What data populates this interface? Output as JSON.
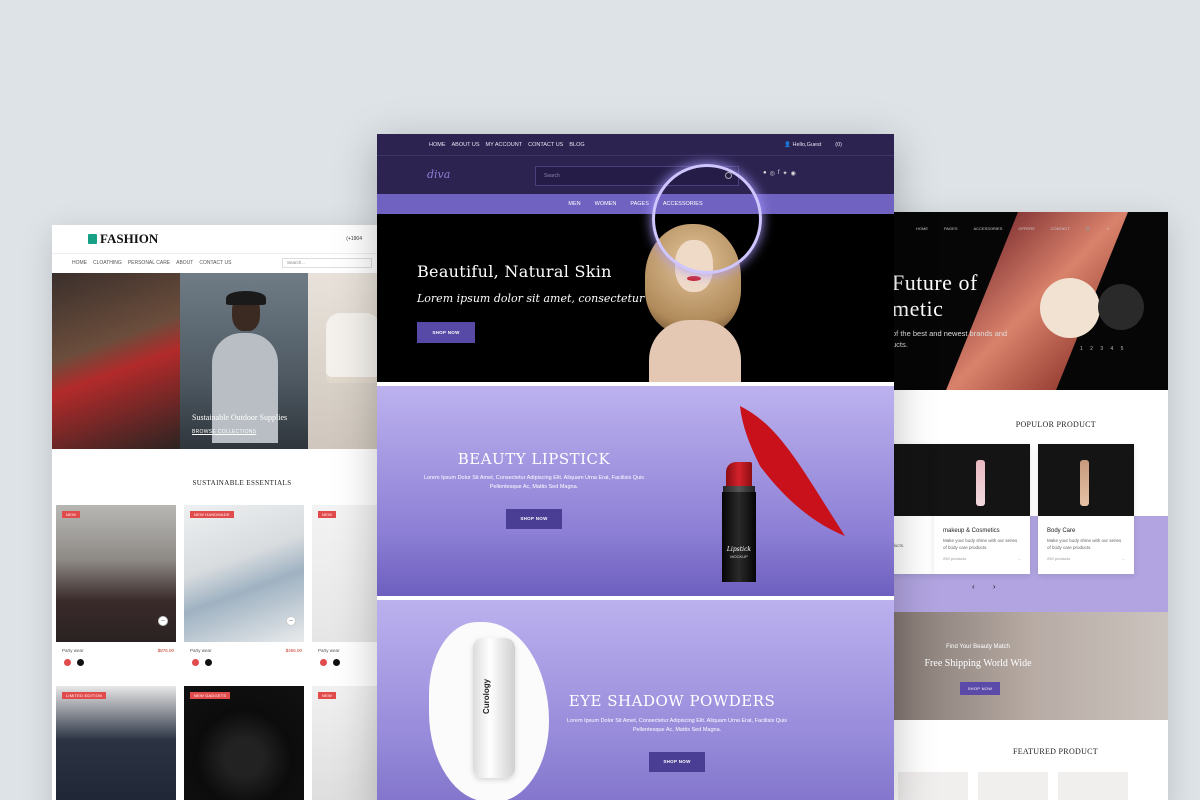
{
  "left": {
    "logo": "FASHION",
    "phone": "(+1904",
    "nav": [
      "HOME",
      "CLOATHING",
      "PERSONAL CARE",
      "ABOUT",
      "CONTACT US"
    ],
    "search_placeholder": "Search...",
    "hero_caption": "Sustainable Outdoor Supplies",
    "hero_link": "BROWSE COLLECTIONS",
    "section_title": "SUSTAINABLE ESSENTIALS",
    "products": [
      {
        "badge": "NEW",
        "category": "Party wear",
        "price": "$876.00"
      },
      {
        "badge": "NEW  HANDMADE",
        "category": "Party wear",
        "price": "$456.00"
      },
      {
        "badge": "NEW",
        "category": "Party wear",
        "price": ""
      }
    ],
    "products_row2": [
      {
        "badge": "LIMITED EDITION"
      },
      {
        "badge": "NEW  GADGETS"
      },
      {
        "badge": "NEW"
      }
    ],
    "swatch_colors": [
      "#e24b4b",
      "#111111"
    ]
  },
  "center": {
    "topnav": [
      "HOME",
      "ABOUT US",
      "MY ACCOUNT",
      "CONTACT US",
      "BLOG"
    ],
    "greeting": "Hello,Guest",
    "cart_count": "(0)",
    "brand": "diva",
    "search_placeholder": "Search",
    "menu": [
      "MEN",
      "WOMEN",
      "PAGES",
      "ACCESSORIES"
    ],
    "hero1": {
      "title": "Beautiful, Natural Skin",
      "subtitle": "Lorem ipsum dolor sit amet, consectetur",
      "button": "SHOP NOW"
    },
    "hero2": {
      "title": "BEAUTY LIPSTICK",
      "desc": "Lorem Ipsum Dolor Sit Amet, Consectetur Adipiscing Elit. Aliquam Urna Erat, Facilisis Quis Pellentesque Ac, Mattis Sed Magna.",
      "button": "SHOP NOW",
      "product_label": "Lipstick",
      "product_sublabel": "MOCKUP"
    },
    "hero3": {
      "title": "EYE SHADOW POWDERS",
      "desc": "Lorem Ipsum Dolor Sit Amet, Consectetur Adipiscing Elit. Aliquam Urna Erat, Facilisis Quis Pellentesque Ac, Mattis Sed Magna.",
      "button": "SHOP NOW",
      "bottle_label": "Curology"
    },
    "accent_color": "#6f62c0",
    "dark_color": "#2c2350"
  },
  "right": {
    "nav": [
      "HOME",
      "PAGES",
      "ACCESSORIES",
      "OFFERS",
      "CONTACT"
    ],
    "hero_title_line1": "Future of",
    "hero_title_line2": "metic",
    "hero_desc": "of the best and newest brands and ucts.",
    "pager": "1 2 3 4 5",
    "popular_title": "POPULOR PRODUCT",
    "products": [
      {
        "title": "makeup & Cosmetics",
        "desc": "Make your body shine with our series of body care products.",
        "count": "250 products"
      },
      {
        "title": "Body Care",
        "desc": "Make your body shine with our series of body care products.",
        "count": "250 products"
      }
    ],
    "partial_desc": "our products.",
    "arrows": "‹ ›",
    "ship_small": "Find Your Beauty Match",
    "ship_big": "Free Shipping World Wide",
    "ship_button": "SHOP NOW",
    "featured_title": "FEATURED PRODUCT"
  }
}
